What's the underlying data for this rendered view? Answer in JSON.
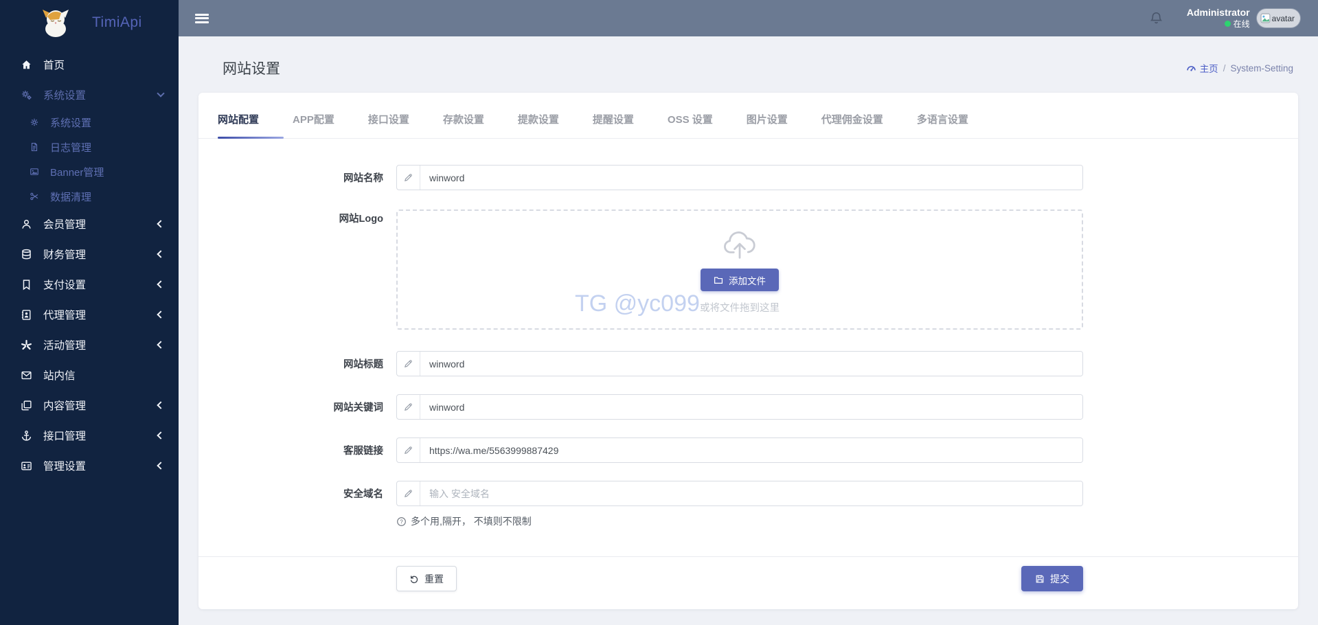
{
  "colors": {
    "accent": "#5a68b8",
    "sidebar_bg": "#112340",
    "topbar_bg": "#6b7a92",
    "online_green": "#2dd36f",
    "active_tab": "#2f3a56",
    "content_bg": "#eff1f6"
  },
  "sidebar": {
    "logo_text": "TimiApi",
    "items": [
      {
        "label": "首页",
        "icon": "home-icon"
      },
      {
        "label": "系统设置",
        "icon": "cogs-icon"
      },
      {
        "label": "系统设置",
        "icon": "cog-icon"
      },
      {
        "label": "日志管理",
        "icon": "file-icon"
      },
      {
        "label": "Banner管理",
        "icon": "image-icon"
      },
      {
        "label": "数据清理",
        "icon": "scissors-icon"
      },
      {
        "label": "会员管理",
        "icon": "user-icon"
      },
      {
        "label": "财务管理",
        "icon": "database-icon"
      },
      {
        "label": "支付设置",
        "icon": "bookmark-icon"
      },
      {
        "label": "代理管理",
        "icon": "address-book-icon"
      },
      {
        "label": "活动管理",
        "icon": "burst-icon"
      },
      {
        "label": "站内信",
        "icon": "envelope-icon"
      },
      {
        "label": "内容管理",
        "icon": "clone-icon"
      },
      {
        "label": "接口管理",
        "icon": "anchor-icon"
      },
      {
        "label": "管理设置",
        "icon": "address-card-icon"
      }
    ]
  },
  "topbar": {
    "admin_name": "Administrator",
    "status_online": "在线",
    "avatar_alt": "avatar"
  },
  "page": {
    "title": "网站设置",
    "breadcrumb": {
      "home": "主页",
      "separator": "/",
      "current": "System-Setting"
    }
  },
  "tabs": [
    "网站配置",
    "APP配置",
    "接口设置",
    "存款设置",
    "提款设置",
    "提醒设置",
    "OSS 设置",
    "图片设置",
    "代理佣金设置",
    "多语言设置"
  ],
  "form": {
    "site_name": {
      "label": "网站名称",
      "value": "winword"
    },
    "site_logo": {
      "label": "网站Logo",
      "add_file_label": "添加文件",
      "drag_text": "或将文件拖到这里",
      "watermark": "TG @yc099"
    },
    "site_title": {
      "label": "网站标题",
      "value": "winword"
    },
    "site_keywords": {
      "label": "网站关键词",
      "value": "winword"
    },
    "service_link": {
      "label": "客服链接",
      "value": "https://wa.me/5563999887429"
    },
    "safe_domain": {
      "label": "安全域名",
      "placeholder": "输入 安全域名",
      "help": "多个用,隔开， 不填则不限制"
    }
  },
  "footer": {
    "reset_label": "重置",
    "submit_label": "提交"
  }
}
